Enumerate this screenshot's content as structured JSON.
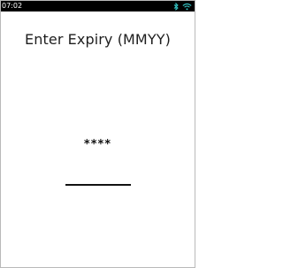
{
  "status_bar": {
    "time": "07:02",
    "icons": [
      "bluetooth-icon",
      "wifi-icon"
    ],
    "icon_color": "#35c8c8",
    "background": "#000000"
  },
  "screen": {
    "title": "Enter Expiry (MMYY)",
    "input_value": "****"
  }
}
